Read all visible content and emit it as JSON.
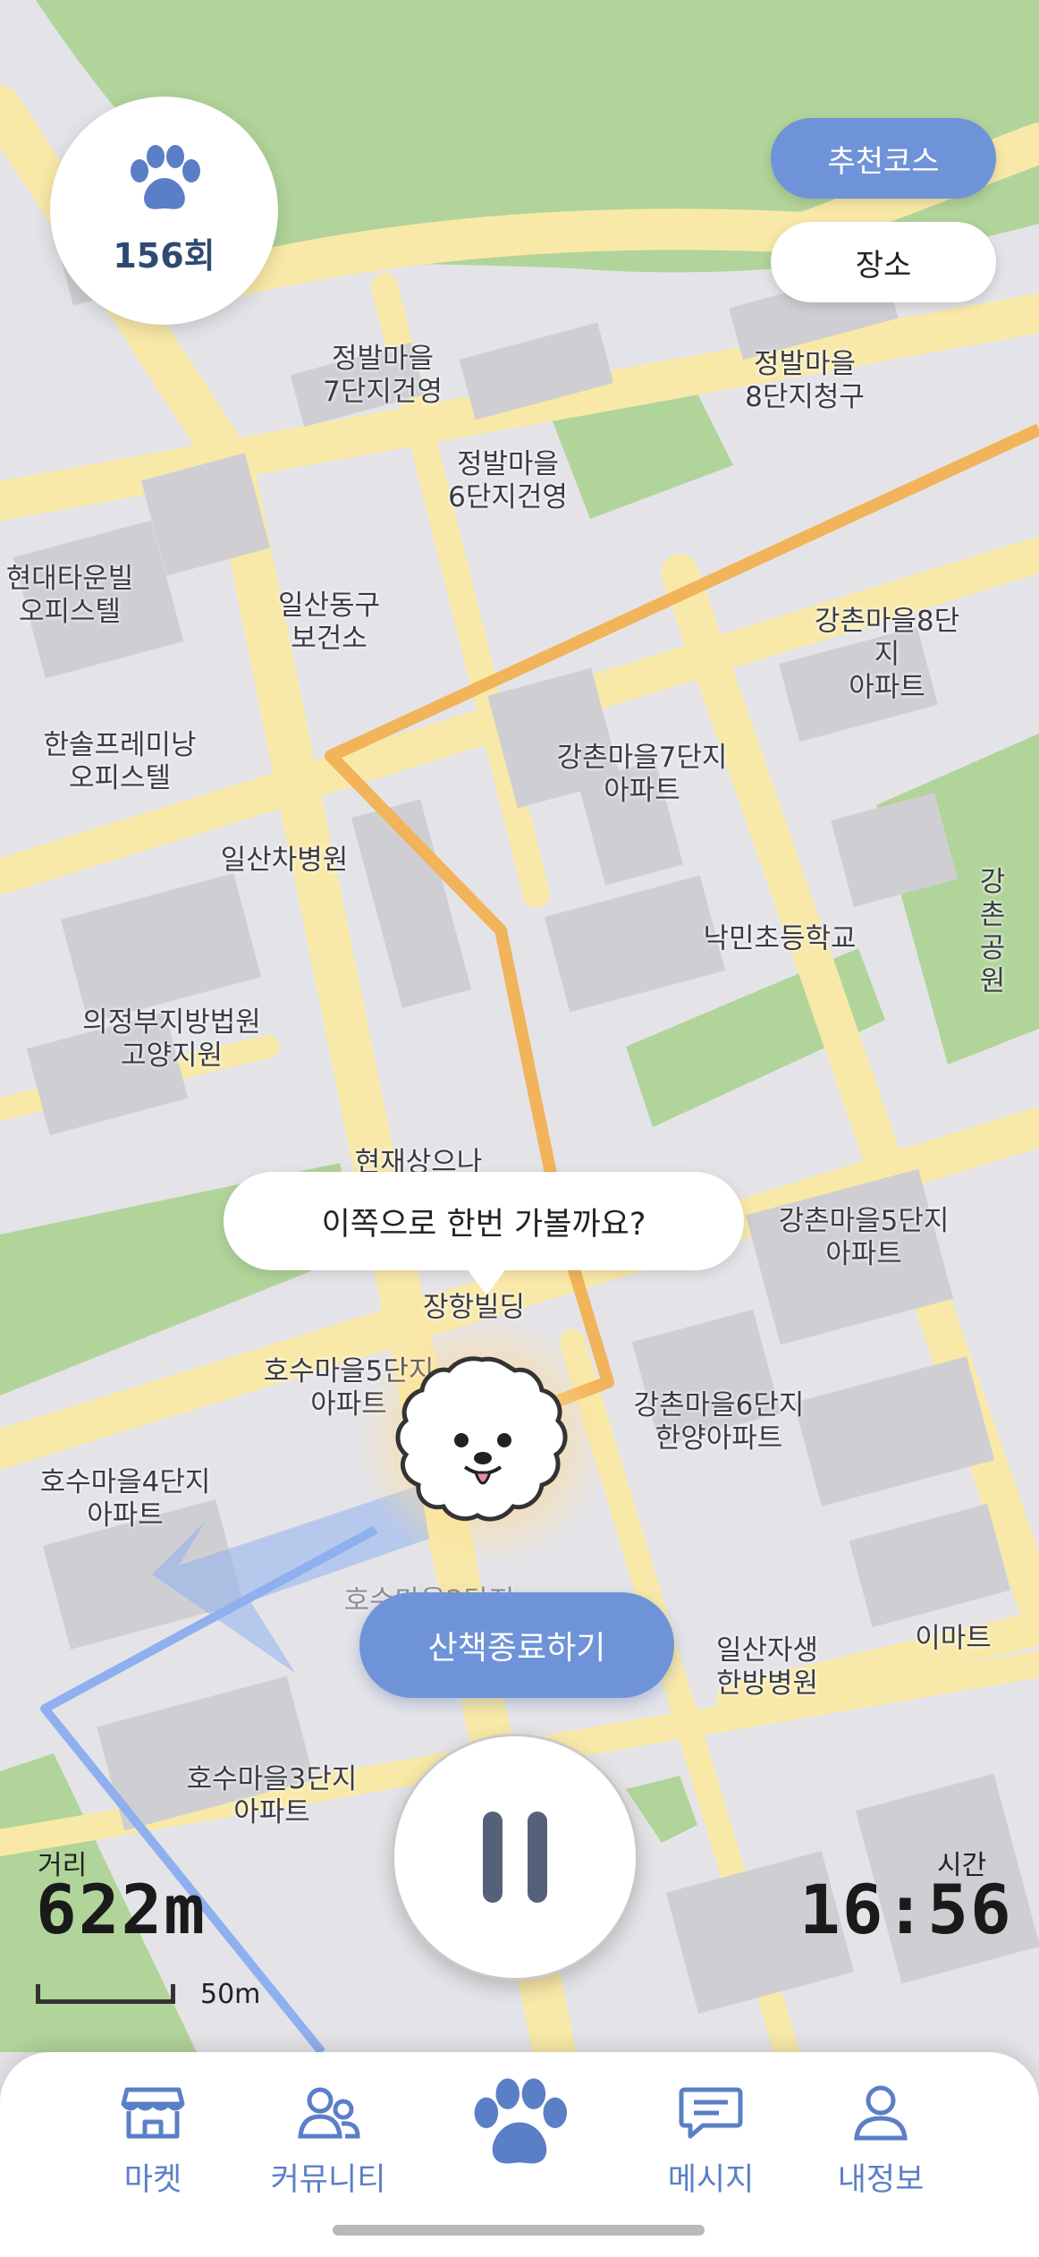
{
  "colors": {
    "accent": "#6f93d8",
    "paw": "#5b7fc6",
    "route_orange": "#f2b45a",
    "walked_blue": "#8fb0ee",
    "park_green": "#b1d49a",
    "road_yellow": "#f9e9a8",
    "block_gray": "#d2d2d6"
  },
  "counter": {
    "icon": "paw-icon",
    "value": "156회"
  },
  "buttons": {
    "recommend": "추천코스",
    "place": "장소",
    "end_walk": "산책종료하기",
    "pause": "pause-icon"
  },
  "bubble": {
    "text": "이쪽으로 한번 가볼까요?"
  },
  "map_labels": [
    "정발마을\n7단지건영",
    "정발마을\n8단지청구",
    "정발마을\n6단지건영",
    "현대타운빌\n오피스텔",
    "일산동구\n보건소",
    "강촌마을8단지\n아파트",
    "한솔프레미낭\n오피스텔",
    "강촌마을7단지\n아파트",
    "일산차병원",
    "낙민초등학교",
    "강촌공원",
    "의정부지방법원\n고양지원",
    "현재상으나",
    "강촌마을5단지\n아파트",
    "장항빌딩",
    "호수마을5단지\n아파트",
    "강촌마을6단지\n한양아파트",
    "호수마을4단지\n아파트",
    "호수마을2단지",
    "일산자생\n한방병원",
    "이마트",
    "호수마을3단지\n아파트"
  ],
  "stats": {
    "distance_label": "거리",
    "distance_value": "622m",
    "time_label": "시간",
    "time_value": "16:56"
  },
  "scale": {
    "label": "50m"
  },
  "tabs": [
    {
      "icon": "market-icon",
      "label": "마켓"
    },
    {
      "icon": "community-icon",
      "label": "커뮤니티"
    },
    {
      "icon": "paw-icon",
      "label": ""
    },
    {
      "icon": "message-icon",
      "label": "메시지"
    },
    {
      "icon": "profile-icon",
      "label": "내정보"
    }
  ]
}
